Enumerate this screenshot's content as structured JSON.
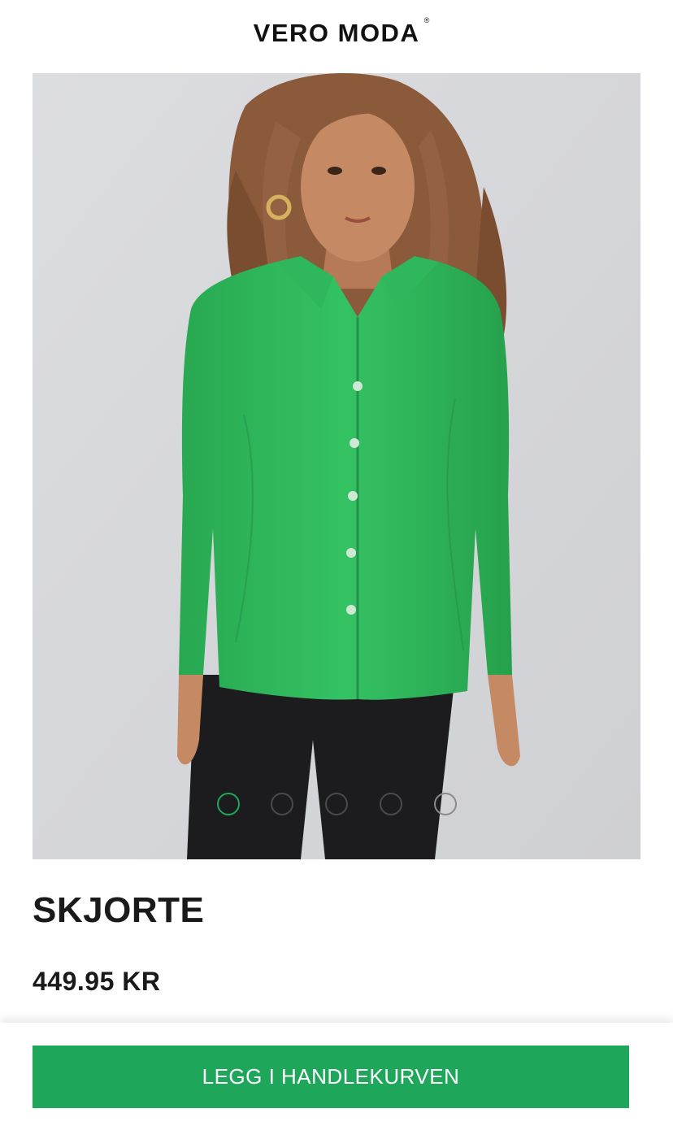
{
  "header": {
    "logo_text": "VERO MODA",
    "logo_mark": "®"
  },
  "gallery": {
    "image_count": 5,
    "active_index": 0,
    "dots": [
      "image-1",
      "image-2",
      "image-3",
      "image-4",
      "image-5"
    ]
  },
  "product": {
    "title": "SKJORTE",
    "price": "449.95 KR"
  },
  "actions": {
    "add_to_cart_label": "LEGG I HANDLEKURVEN"
  },
  "colors": {
    "accent": "#1ea75a",
    "shirt": "#2fbb5c",
    "background_image": "#d8d9dc"
  }
}
